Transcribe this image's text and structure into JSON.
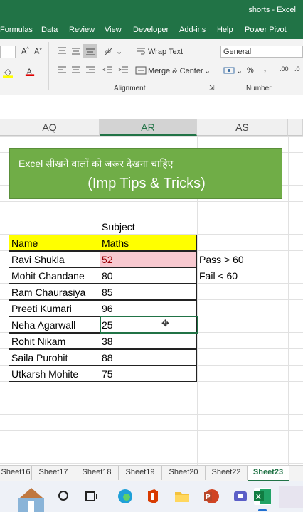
{
  "titlebar": {
    "text": "shorts  -  Excel"
  },
  "menu": [
    "Formulas",
    "Data",
    "Review",
    "View",
    "Developer",
    "Add-ins",
    "Help",
    "Power Pivot"
  ],
  "ribbon": {
    "wrap_text": "Wrap Text",
    "merge_center": "Merge & Center",
    "number_format": "General",
    "alignment_group": "Alignment",
    "number_group": "Number"
  },
  "columns": [
    "AQ",
    "AR",
    "AS"
  ],
  "banner": {
    "line1": "Excel सीखने वालों को जरूर देखना चाहिए",
    "line2": "(Imp Tips & Tricks)"
  },
  "table": {
    "group_header": "Subject",
    "headers": [
      "Name",
      "Maths"
    ],
    "rows": [
      {
        "name": "Ravi Shukla",
        "score": "52"
      },
      {
        "name": "Mohit Chandane",
        "score": "80"
      },
      {
        "name": "Ram Chaurasiya",
        "score": "85"
      },
      {
        "name": "Preeti Kumari",
        "score": "96"
      },
      {
        "name": "Neha Agarwall",
        "score": "25"
      },
      {
        "name": "Rohit Nikam",
        "score": "38"
      },
      {
        "name": "Saila Purohit",
        "score": "88"
      },
      {
        "name": "Utkarsh Mohite",
        "score": "75"
      }
    ]
  },
  "rules": [
    "Pass > 60",
    "Fail < 60"
  ],
  "sheet_tabs": [
    "Sheet16",
    "Sheet17",
    "Sheet18",
    "Sheet19",
    "Sheet20",
    "Sheet22",
    "Sheet23"
  ],
  "active_sheet": "Sheet23",
  "colors": {
    "excel_green": "#217346",
    "header_yellow": "#ffff00",
    "fail_fill": "#f8c9d0",
    "banner_green": "#70ad47"
  }
}
